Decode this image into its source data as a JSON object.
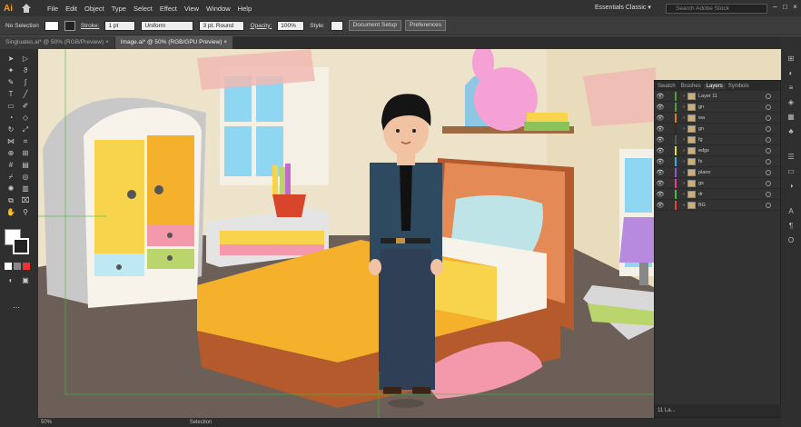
{
  "app": {
    "logo": "Ai",
    "workspace": "Essentials Classic ▾",
    "search_placeholder": "Search Adobe Stock"
  },
  "menu": [
    "File",
    "Edit",
    "Object",
    "Type",
    "Select",
    "Effect",
    "View",
    "Window",
    "Help"
  ],
  "control_bar": {
    "selection": "No Selection",
    "stroke_label": "Stroke:",
    "stroke_value": "1 pt",
    "profile": "Uniform",
    "brush": "3 pt. Round",
    "opacity_label": "Opacity:",
    "opacity_value": "100%",
    "style_label": "Style:",
    "doc_setup": "Document Setup",
    "preferences": "Preferences"
  },
  "tabs": [
    {
      "label": "Singluates.ai* @ 50% (RGB/Preview)",
      "close": "×"
    },
    {
      "label": "Image.ai* @ 50% (RGB/GPU Preview)",
      "close": "×"
    }
  ],
  "layers_panel": {
    "tabs": [
      "Swatch",
      "Brushes",
      "Layers",
      "Symbols"
    ],
    "active_tab": "Layers",
    "rows": [
      {
        "name": "Layer 11",
        "color": "#4f9f35"
      },
      {
        "name": "gn",
        "color": "#4f9f35"
      },
      {
        "name": "wa",
        "color": "#e07a2a"
      },
      {
        "name": "gn",
        "color": "#2a2a2a"
      },
      {
        "name": "fg",
        "color": "#555555"
      },
      {
        "name": "edgs",
        "color": "#e0e030"
      },
      {
        "name": "fs",
        "color": "#38b0e0"
      },
      {
        "name": "plano",
        "color": "#a050c8"
      },
      {
        "name": "gs",
        "color": "#e0409a"
      },
      {
        "name": "dr",
        "color": "#40c040"
      },
      {
        "name": "BG",
        "color": "#e04040"
      }
    ],
    "footer": "11 La..."
  },
  "status": {
    "zoom": "50%",
    "tool": "Selection"
  },
  "colors": {
    "wall": "#ede3ca",
    "floor": "#6b5f57",
    "bed_orange": "#f5b12b",
    "wood": "#b45a2c"
  }
}
